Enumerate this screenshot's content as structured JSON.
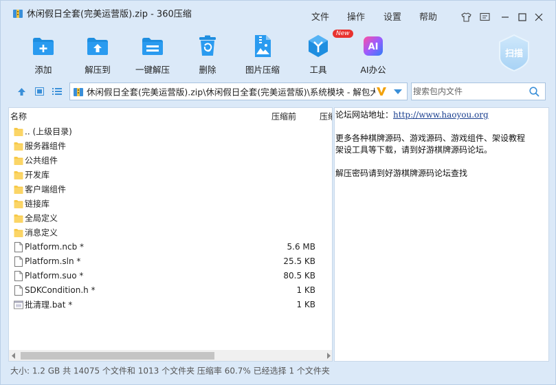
{
  "window": {
    "title": "休闲假日全套(完美运营版).zip - 360压缩",
    "menu": [
      "文件",
      "操作",
      "设置",
      "帮助"
    ]
  },
  "toolbar": {
    "items": [
      {
        "label": "添加",
        "icon": "add-file-icon"
      },
      {
        "label": "解压到",
        "icon": "extract-to-icon"
      },
      {
        "label": "一键解压",
        "icon": "one-click-extract-icon"
      },
      {
        "label": "删除",
        "icon": "trash-icon"
      },
      {
        "label": "图片压缩",
        "icon": "image-compress-icon"
      },
      {
        "label": "工具",
        "icon": "tools-icon",
        "badge": "New"
      },
      {
        "label": "AI办公",
        "icon": "ai-office-icon",
        "glyph": "AI"
      }
    ],
    "scan": "扫描"
  },
  "nav": {
    "path": "休闲假日全套(完美运营版).zip\\休闲假日全套(完美运营版)\\系统模块 - 解包大小",
    "search_placeholder": "搜索包内文件"
  },
  "list": {
    "columns": {
      "name": "名称",
      "before": "压缩前",
      "after": "压缩"
    },
    "rows": [
      {
        "name": ".. (上级目录)",
        "size": "",
        "type": "folder"
      },
      {
        "name": "服务器组件",
        "size": "",
        "type": "folder"
      },
      {
        "name": "公共组件",
        "size": "",
        "type": "folder"
      },
      {
        "name": "开发库",
        "size": "",
        "type": "folder"
      },
      {
        "name": "客户端组件",
        "size": "",
        "type": "folder"
      },
      {
        "name": "链接库",
        "size": "",
        "type": "folder"
      },
      {
        "name": "全局定义",
        "size": "",
        "type": "folder"
      },
      {
        "name": "消息定义",
        "size": "",
        "type": "folder"
      },
      {
        "name": "Platform.ncb *",
        "size": "5.6 MB",
        "type": "file"
      },
      {
        "name": "Platform.sln *",
        "size": "25.5 KB",
        "type": "file"
      },
      {
        "name": "Platform.suo *",
        "size": "80.5 KB",
        "type": "file"
      },
      {
        "name": "SDKCondition.h *",
        "size": "1 KB",
        "type": "file"
      },
      {
        "name": "批清理.bat *",
        "size": "1 KB",
        "type": "bat"
      }
    ]
  },
  "comment": {
    "line1_label": "论坛网站地址：",
    "line1_link": "http://www.haoyou.org",
    "line2": "更多各种棋牌源码、游戏源码、游戏组件、架设教程",
    "line3": "架设工具等下载，请到好游棋牌源码论坛。",
    "line4": "解压密码请到好游棋牌源码论坛查找"
  },
  "status": {
    "text": "大小: 1.2 GB 共 14075 个文件和 1013 个文件夹 压缩率 60.7% 已经选择 1 个文件夹"
  },
  "colors": {
    "accent": "#1e8ee0",
    "window_bg": "#dbe9f8",
    "folder": "#f7c948",
    "vip": "#f2a20b",
    "new_badge": "#e8322f"
  }
}
